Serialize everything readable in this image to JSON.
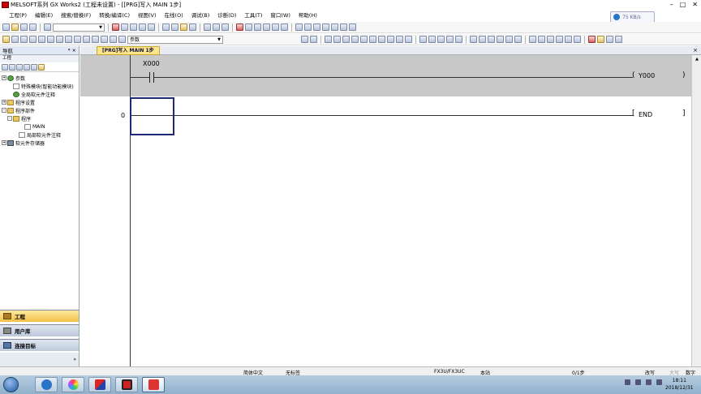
{
  "window": {
    "title": "MELSOFT系列 GX Works2 (工程未设置) - [[PRG]写入 MAIN 1步]",
    "network_speed": "75 KB/s"
  },
  "menu": [
    "工程(P)",
    "编辑(E)",
    "搜索/替换(F)",
    "转换/编译(C)",
    "视图(V)",
    "在线(O)",
    "调试(B)",
    "诊断(D)",
    "工具(T)",
    "窗口(W)",
    "帮助(H)"
  ],
  "toolbar": {
    "device_combo_value": "参数"
  },
  "nav": {
    "title": "导航",
    "pin": "ᵠ ×",
    "subtitle": "工程",
    "tree": [
      {
        "label": "参数",
        "indent": 0,
        "exp": "+",
        "icon": "globe"
      },
      {
        "label": "特殊模块(智能功能模块)",
        "indent": 1,
        "exp": "",
        "icon": "doc"
      },
      {
        "label": "全局软元件注释",
        "indent": 1,
        "exp": "",
        "icon": "globe"
      },
      {
        "label": "程序设置",
        "indent": 0,
        "exp": "+",
        "icon": "folder"
      },
      {
        "label": "程序部件",
        "indent": 0,
        "exp": "-",
        "icon": "folder"
      },
      {
        "label": "程序",
        "indent": 1,
        "exp": "-",
        "icon": "folder"
      },
      {
        "label": "MAIN",
        "indent": 3,
        "exp": "",
        "icon": "doc"
      },
      {
        "label": "局部软元件注释",
        "indent": 2,
        "exp": "",
        "icon": "doc"
      },
      {
        "label": "软元件存储器",
        "indent": 0,
        "exp": "+",
        "icon": "chip"
      }
    ],
    "buttons": [
      "工程",
      "用户库",
      "连接目标"
    ]
  },
  "doc_tab": {
    "label": "[PRG]写入 MAIN 1步",
    "close": "×"
  },
  "ladder": {
    "contact": "X000",
    "coil": "Y000",
    "end": "END",
    "step": "0"
  },
  "status": {
    "lang": "简体中文",
    "label": "无标签",
    "cpu": "FX3U/FX3UC",
    "station": "本站",
    "steps": "0/1步",
    "mode": "改写",
    "caps": "大写",
    "num": "数字"
  },
  "clock": {
    "time": "18:11",
    "date": "2018/12/31"
  }
}
